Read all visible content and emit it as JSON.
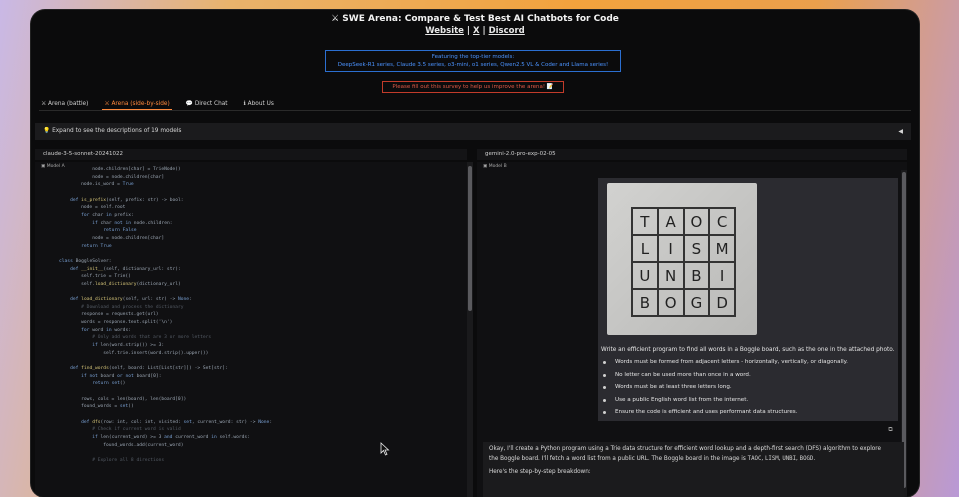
{
  "header": {
    "title_icon": "swords-icon",
    "title": "SWE Arena: Compare & Test Best AI Chatbots for Code",
    "links": [
      "Website",
      "X",
      "Discord"
    ],
    "separator": " | "
  },
  "featured": {
    "line1": "Featuring the top-tier models:",
    "line2": "DeepSeek-R1 series, Claude 3.5 series, o3-mini, o1 series, Qwen2.5 VL & Coder and Llama series!"
  },
  "survey": {
    "text": "Please fill out this survey to help us improve the arena!",
    "icon": "memo-icon"
  },
  "tabs": [
    {
      "label": "Arena (battle)",
      "icon": "swords-icon",
      "active": false
    },
    {
      "label": "Arena (side-by-side)",
      "icon": "swords-icon",
      "active": true
    },
    {
      "label": "Direct Chat",
      "icon": "speech-bubble-icon",
      "active": false
    },
    {
      "label": "About Us",
      "icon": "info-icon",
      "active": false
    }
  ],
  "expand": {
    "icon": "lightbulb-icon",
    "label": "Expand to see the descriptions of 19 models",
    "toggle": "◀"
  },
  "left": {
    "model_name": "claude-3-5-sonnet-20241022",
    "pane_label": "Model A",
    "code_lines": [
      "            node.children[char] = TrieNode()",
      "            node = node.children[char]",
      "        node.is_word = True",
      "",
      "    def is_prefix(self, prefix: str) -> bool:",
      "        node = self.root",
      "        for char in prefix:",
      "            if char not in node.children:",
      "                return False",
      "            node = node.children[char]",
      "        return True",
      "",
      "class BoggleSolver:",
      "    def __init__(self, dictionary_url: str):",
      "        self.trie = Trie()",
      "        self.load_dictionary(dictionary_url)",
      "",
      "    def load_dictionary(self, url: str) -> None:",
      "        # Download and process the dictionary",
      "        response = requests.get(url)",
      "        words = response.text.split('\\n')",
      "        for word in words:",
      "            # Only add words that are 3 or more letters",
      "            if len(word.strip()) >= 3:",
      "                self.trie.insert(word.strip().upper())",
      "",
      "    def find_words(self, board: List[List[str]]) -> Set[str]:",
      "        if not board or not board[0]:",
      "            return set()",
      "",
      "        rows, cols = len(board), len(board[0])",
      "        found_words = set()",
      "",
      "        def dfs(row: int, col: int, visited: set, current_word: str) -> None:",
      "            # Check if current word is valid",
      "            if len(current_word) >= 3 and current_word in self.words:",
      "                found_words.add(current_word)",
      "",
      "            # Explore all 8 directions"
    ]
  },
  "right": {
    "model_name": "gemini-2.0-pro-exp-02-05",
    "pane_label": "Model B",
    "photo_letters": [
      [
        "T",
        "A",
        "O",
        "C"
      ],
      [
        "L",
        "I",
        "S",
        "M"
      ],
      [
        "U",
        "N",
        "B",
        "I"
      ],
      [
        "B",
        "O",
        "G",
        "D"
      ]
    ],
    "prompt_intro": "Write an efficient program to find all words in a Boggle board, such as the one in the attached photo.",
    "prompt_bullets": [
      "Words must be formed from adjacent letters - horizontally, vertically, or diagonally.",
      "No letter can be used more than once in a word.",
      "Words must be at least three letters long.",
      "Use a public English word list from the internet.",
      "Ensure the code is efficient and uses performant data structures."
    ],
    "copy_icon": "copy-icon",
    "answer_line1": "Okay, I'll create a Python program using a Trie data structure for efficient word lookup and a depth-first search (DFS) algorithm to explore",
    "answer_line2_pre": "the Boggle board. I'll fetch a word list from a public URL. The Boggle board in the image is ",
    "answer_codes": [
      "TAOC",
      "LISM",
      "UNBI",
      "BOGD"
    ],
    "answer_line3": "Here's the step-by-step breakdown:"
  }
}
